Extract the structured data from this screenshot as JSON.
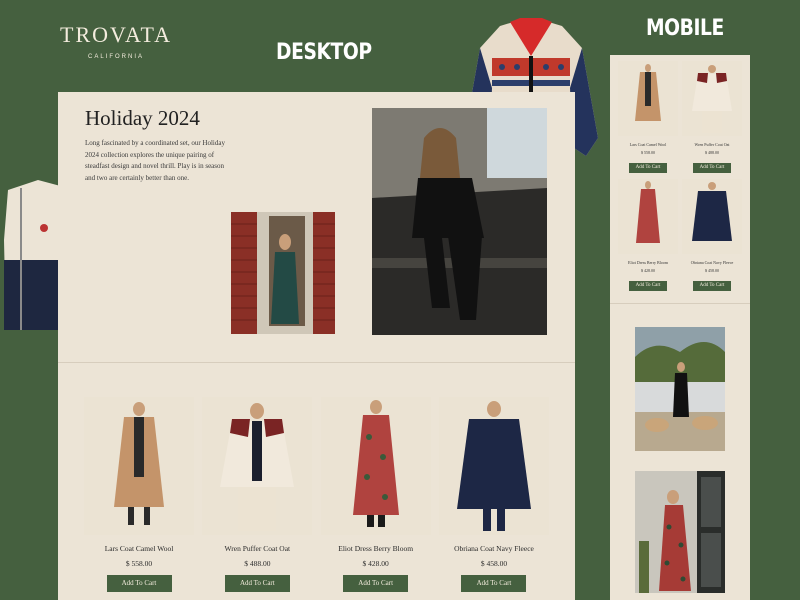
{
  "brand": {
    "name": "TROVATA",
    "tagline": "CALIFORNIA"
  },
  "labels": {
    "desktop": "DESKTOP",
    "mobile": "MOBILE"
  },
  "hero": {
    "title": "Holiday 2024",
    "text": "Long fascinated by a coordinated set, our Holiday 2024 collection explores the unique pairing of steadfast design and novel thrill. Play is in season and two are certainly better than one."
  },
  "products": [
    {
      "name": "Lars Coat Camel Wool",
      "price": "$ 558.00",
      "button": "Add To Cart"
    },
    {
      "name": "Wren Puffer Coat Oat",
      "price": "$ 488.00",
      "button": "Add To Cart"
    },
    {
      "name": "Eliot Dress Berry Bloom",
      "price": "$ 428.00",
      "button": "Add To Cart"
    },
    {
      "name": "Obriana Coat Navy Fleece",
      "price": "$ 458.00",
      "button": "Add To Cart"
    }
  ],
  "colors": {
    "background": "#45603f",
    "page": "#ece4d6",
    "button": "#45603f",
    "button_text": "#f3ecdd"
  }
}
